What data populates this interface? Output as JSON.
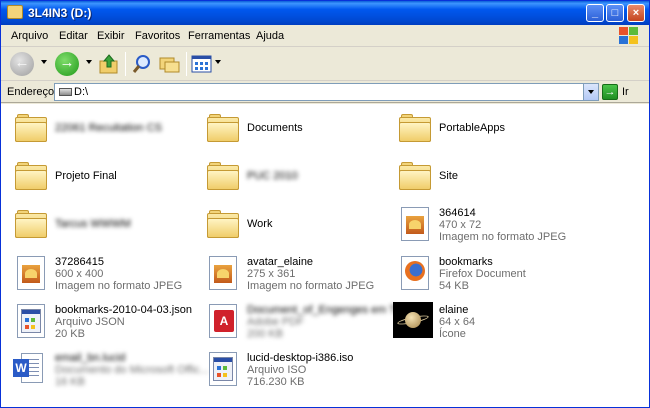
{
  "window": {
    "title": "3L4IN3 (D:)"
  },
  "menu": [
    "Arquivo",
    "Editar",
    "Exibir",
    "Favoritos",
    "Ferramentas",
    "Ajuda"
  ],
  "address": {
    "label": "Endereço",
    "path": "D:\\",
    "go_label": "Ir"
  },
  "colors": {
    "titlebar": "#0058ee",
    "chrome": "#ece9d8",
    "folder": "#f0cd6a",
    "detail_text": "#6d6d6d"
  },
  "files": [
    {
      "name": "22061 Recuitation CS",
      "icon": "folder-icon",
      "obscured": true
    },
    {
      "name": "Documents",
      "icon": "folder-icon"
    },
    {
      "name": "PortableApps",
      "icon": "folder-icon"
    },
    {
      "name": "Projeto Final",
      "icon": "folder-icon"
    },
    {
      "name": "PUC 2010",
      "icon": "folder-icon",
      "obscured": true
    },
    {
      "name": "Site",
      "icon": "folder-icon"
    },
    {
      "name": "Tarcus WWWM",
      "icon": "folder-icon",
      "obscured": true
    },
    {
      "name": "Work",
      "icon": "folder-icon"
    },
    {
      "name": "364614",
      "icon": "jpeg-icon",
      "line2": "470 x 72",
      "line3": "Imagem no formato JPEG"
    },
    {
      "name": "37286415",
      "icon": "jpeg-icon",
      "line2": "600 x 400",
      "line3": "Imagem no formato JPEG"
    },
    {
      "name": "avatar_elaine",
      "icon": "jpeg-icon",
      "line2": "275 x 361",
      "line3": "Imagem no formato JPEG"
    },
    {
      "name": "bookmarks",
      "icon": "firefox-icon",
      "line2": "Firefox Document",
      "line3": "54 KB"
    },
    {
      "name": "bookmarks-2010-04-03.json",
      "icon": "json-icon",
      "line2": "Arquivo JSON",
      "line3": "20 KB"
    },
    {
      "name": "Document_of_Engenges em T...",
      "icon": "pdf-icon",
      "line2": "Adobe PDF",
      "line3": "200 KB",
      "obscured": true
    },
    {
      "name": "elaine",
      "icon": "saturn-icon",
      "line2": "64 x 64",
      "line3": "Ícone"
    },
    {
      "name": "email_bn.lucid",
      "icon": "word-icon",
      "line2": "Documento do Microsoft Offic...",
      "line3": "16 KB",
      "obscured": true
    },
    {
      "name": "lucid-desktop-i386.iso",
      "icon": "iso-icon",
      "line2": "Arquivo ISO",
      "line3": "716.230 KB"
    }
  ]
}
